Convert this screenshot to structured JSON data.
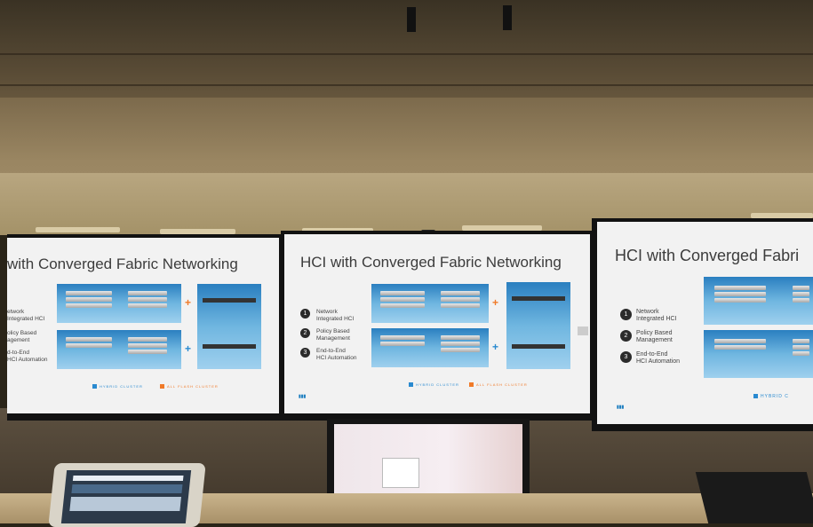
{
  "screens": {
    "left": {
      "title": "with Converged Fabric Networking",
      "items": [
        "etwork\nIntegrated HCI",
        "olicy Based\nagement",
        "d-to-End\nHCI Automation"
      ],
      "legend_hybrid": "HYBRID CLUSTER",
      "legend_allflash": "ALL FLASH CLUSTER"
    },
    "center": {
      "title": "HCI with Converged Fabric Networking",
      "items": [
        {
          "num": "1",
          "text": "Network\nIntegrated HCI"
        },
        {
          "num": "2",
          "text": "Policy Based\nManagement"
        },
        {
          "num": "3",
          "text": "End-to-End\nHCI Automation"
        }
      ],
      "legend_hybrid": "HYBRID CLUSTER",
      "legend_allflash": "ALL FLASH CLUSTER"
    },
    "right": {
      "title": "HCI with Converged Fabri",
      "items": [
        {
          "num": "1",
          "text": "Network\nIntegrated HCI"
        },
        {
          "num": "2",
          "text": "Policy Based\nManagement"
        },
        {
          "num": "3",
          "text": "End-to-End\nHCI Automation"
        }
      ],
      "legend_hybrid": "HYBRID C"
    }
  },
  "colors": {
    "hybrid": "#2a8ad0",
    "allflash": "#f07a28",
    "screen_bg": "#f2f2f2"
  }
}
